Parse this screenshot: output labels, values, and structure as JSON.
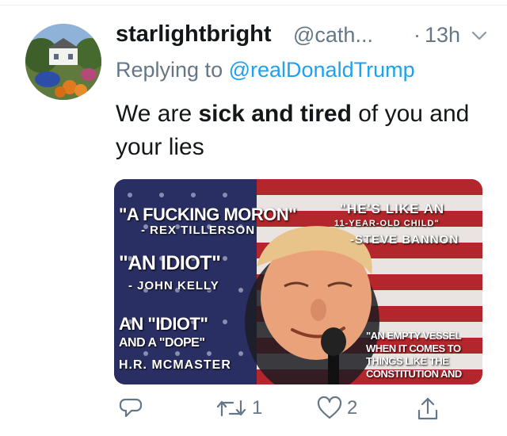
{
  "tweet": {
    "display_name": "starlightbright",
    "handle": "@cath...",
    "separator": "·",
    "time": "13h",
    "reply_prefix": "Replying to ",
    "reply_to": "@realDonaldTrump",
    "text_before": "We are ",
    "text_bold": "sick and tired",
    "text_after": " of you and your lies"
  },
  "media": {
    "quotes": [
      {
        "text": "\"A FUCKING MORON\"",
        "size": "big"
      },
      {
        "text": "- REX TILLERSON",
        "size": "small"
      },
      {
        "text": "\"AN IDIOT\"",
        "size": "big"
      },
      {
        "text": "- JOHN KELLY",
        "size": "small"
      },
      {
        "text": "AN \"IDIOT\"",
        "size": "big"
      },
      {
        "text": "AND A \"DOPE\"",
        "size": "small"
      },
      {
        "text": "H.R. MCMASTER",
        "size": "small"
      },
      {
        "text": "\"HE'S LIKE AN",
        "size": "mid"
      },
      {
        "text": "11-YEAR-OLD CHILD\"",
        "size": "tiny"
      },
      {
        "text": "-STEVE BANNON",
        "size": "small"
      },
      {
        "text": "\"AN EMPTY VESSEL",
        "size": "tiny"
      },
      {
        "text": "WHEN IT COMES TO",
        "size": "tiny"
      },
      {
        "text": "THINGS LIKE THE",
        "size": "tiny"
      },
      {
        "text": "CONSTITUTION AND",
        "size": "tiny"
      }
    ]
  },
  "actions": {
    "reply_count": "",
    "retweet_count": "1",
    "like_count": "2",
    "share_count": ""
  },
  "icons": {
    "reply": "reply-icon",
    "retweet": "retweet-icon",
    "like": "heart-icon",
    "share": "share-icon",
    "menu": "chevron-down-icon"
  },
  "colors": {
    "primary_text": "#14171a",
    "secondary_text": "#657786",
    "link": "#1da1f2"
  }
}
